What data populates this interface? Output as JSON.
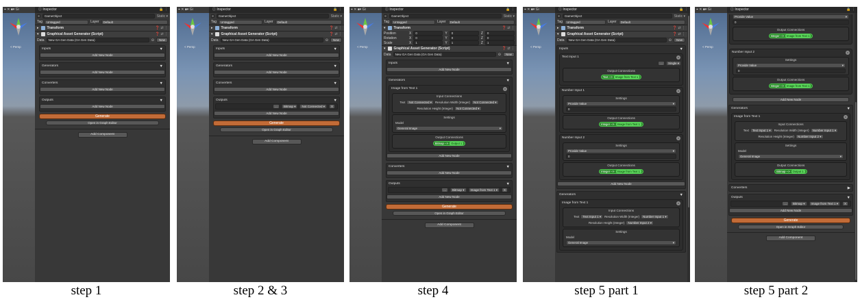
{
  "common": {
    "scene_toolbar": "⌖ ✕ ■▾ Gi",
    "persp_label": "< Persp",
    "inspector_title": "Inspector",
    "inspector_lock": "🔒 ⋮",
    "gameobject_name": "GameObject",
    "static_label": "Static ▾",
    "tag_label": "Tag",
    "tag_value": "Untagged",
    "layer_label": "Layer",
    "layer_value": "Default",
    "transform_title": "Transform",
    "component_title": "Graphical Asset Generator (Script)",
    "component_icons": "❓ ⇄ ⋮",
    "data_label": "Data",
    "data_value": "New GA Gen Data (GA Gen Data)",
    "new_button": "New",
    "inputs_label": "Inputs",
    "generators_label": "Generators",
    "converters_label": "Converters",
    "outputs_label": "Outputs",
    "add_new_node": "Add New Node",
    "generate": "Generate",
    "open_graph": "Open in Graph Editor",
    "add_component": "Add Component",
    "position_label": "Position",
    "rotation_label": "Rotation",
    "scale_label": "Scale",
    "x_label": "X",
    "y_label": "Y",
    "z_label": "Z",
    "pos_values": [
      "0",
      "0",
      "0"
    ],
    "rot_values": [
      "0",
      "0",
      "0"
    ],
    "scale_values": [
      "1",
      "1",
      "1"
    ],
    "bitmap": "Bitmap ▾",
    "not_connected": "Not Connected ▾",
    "image_from_text_sel": "Image from Text 1 ▾",
    "remove_x": "X",
    "ellipsis": "...",
    "image_from_text_1": "Image from Text 1",
    "input_connections": "Input Connections",
    "text_label": "Text",
    "res_width_label": "Resolution Width (Integer)",
    "res_height_label": "Resolution Height (Integer)",
    "settings": "Settings",
    "model_label": "Model",
    "model_value": "General Image",
    "output_connections": "Output Connections",
    "bitmap_arrow": "Bitmap -->",
    "output_1": "Output 1",
    "text_input_1": "Text Input 1",
    "number_input_1": "Number Input 1",
    "number_input_2": "Number Input 2",
    "single": "Single ▾",
    "text_arrow": "Text -->",
    "integer_arrow": "Integer -->",
    "image_from_text_tag": "Image from Text 1",
    "provide_value": "Provide Value",
    "zero": "0",
    "text_input_1_sel": "Text Input 1 ▾",
    "number_input_1_sel": "Number Input 1 ▾",
    "number_input_2_sel": "Number Input 2 ▾",
    "close_x": "x"
  },
  "captions": [
    "step 1",
    "step 2 & 3",
    "step 4",
    "step 5 part 1",
    "step 5 part 2"
  ],
  "colors": {
    "generate": "#c26b37",
    "connection_pill": "#2d8a2d",
    "inspector_bg": "#383838"
  }
}
